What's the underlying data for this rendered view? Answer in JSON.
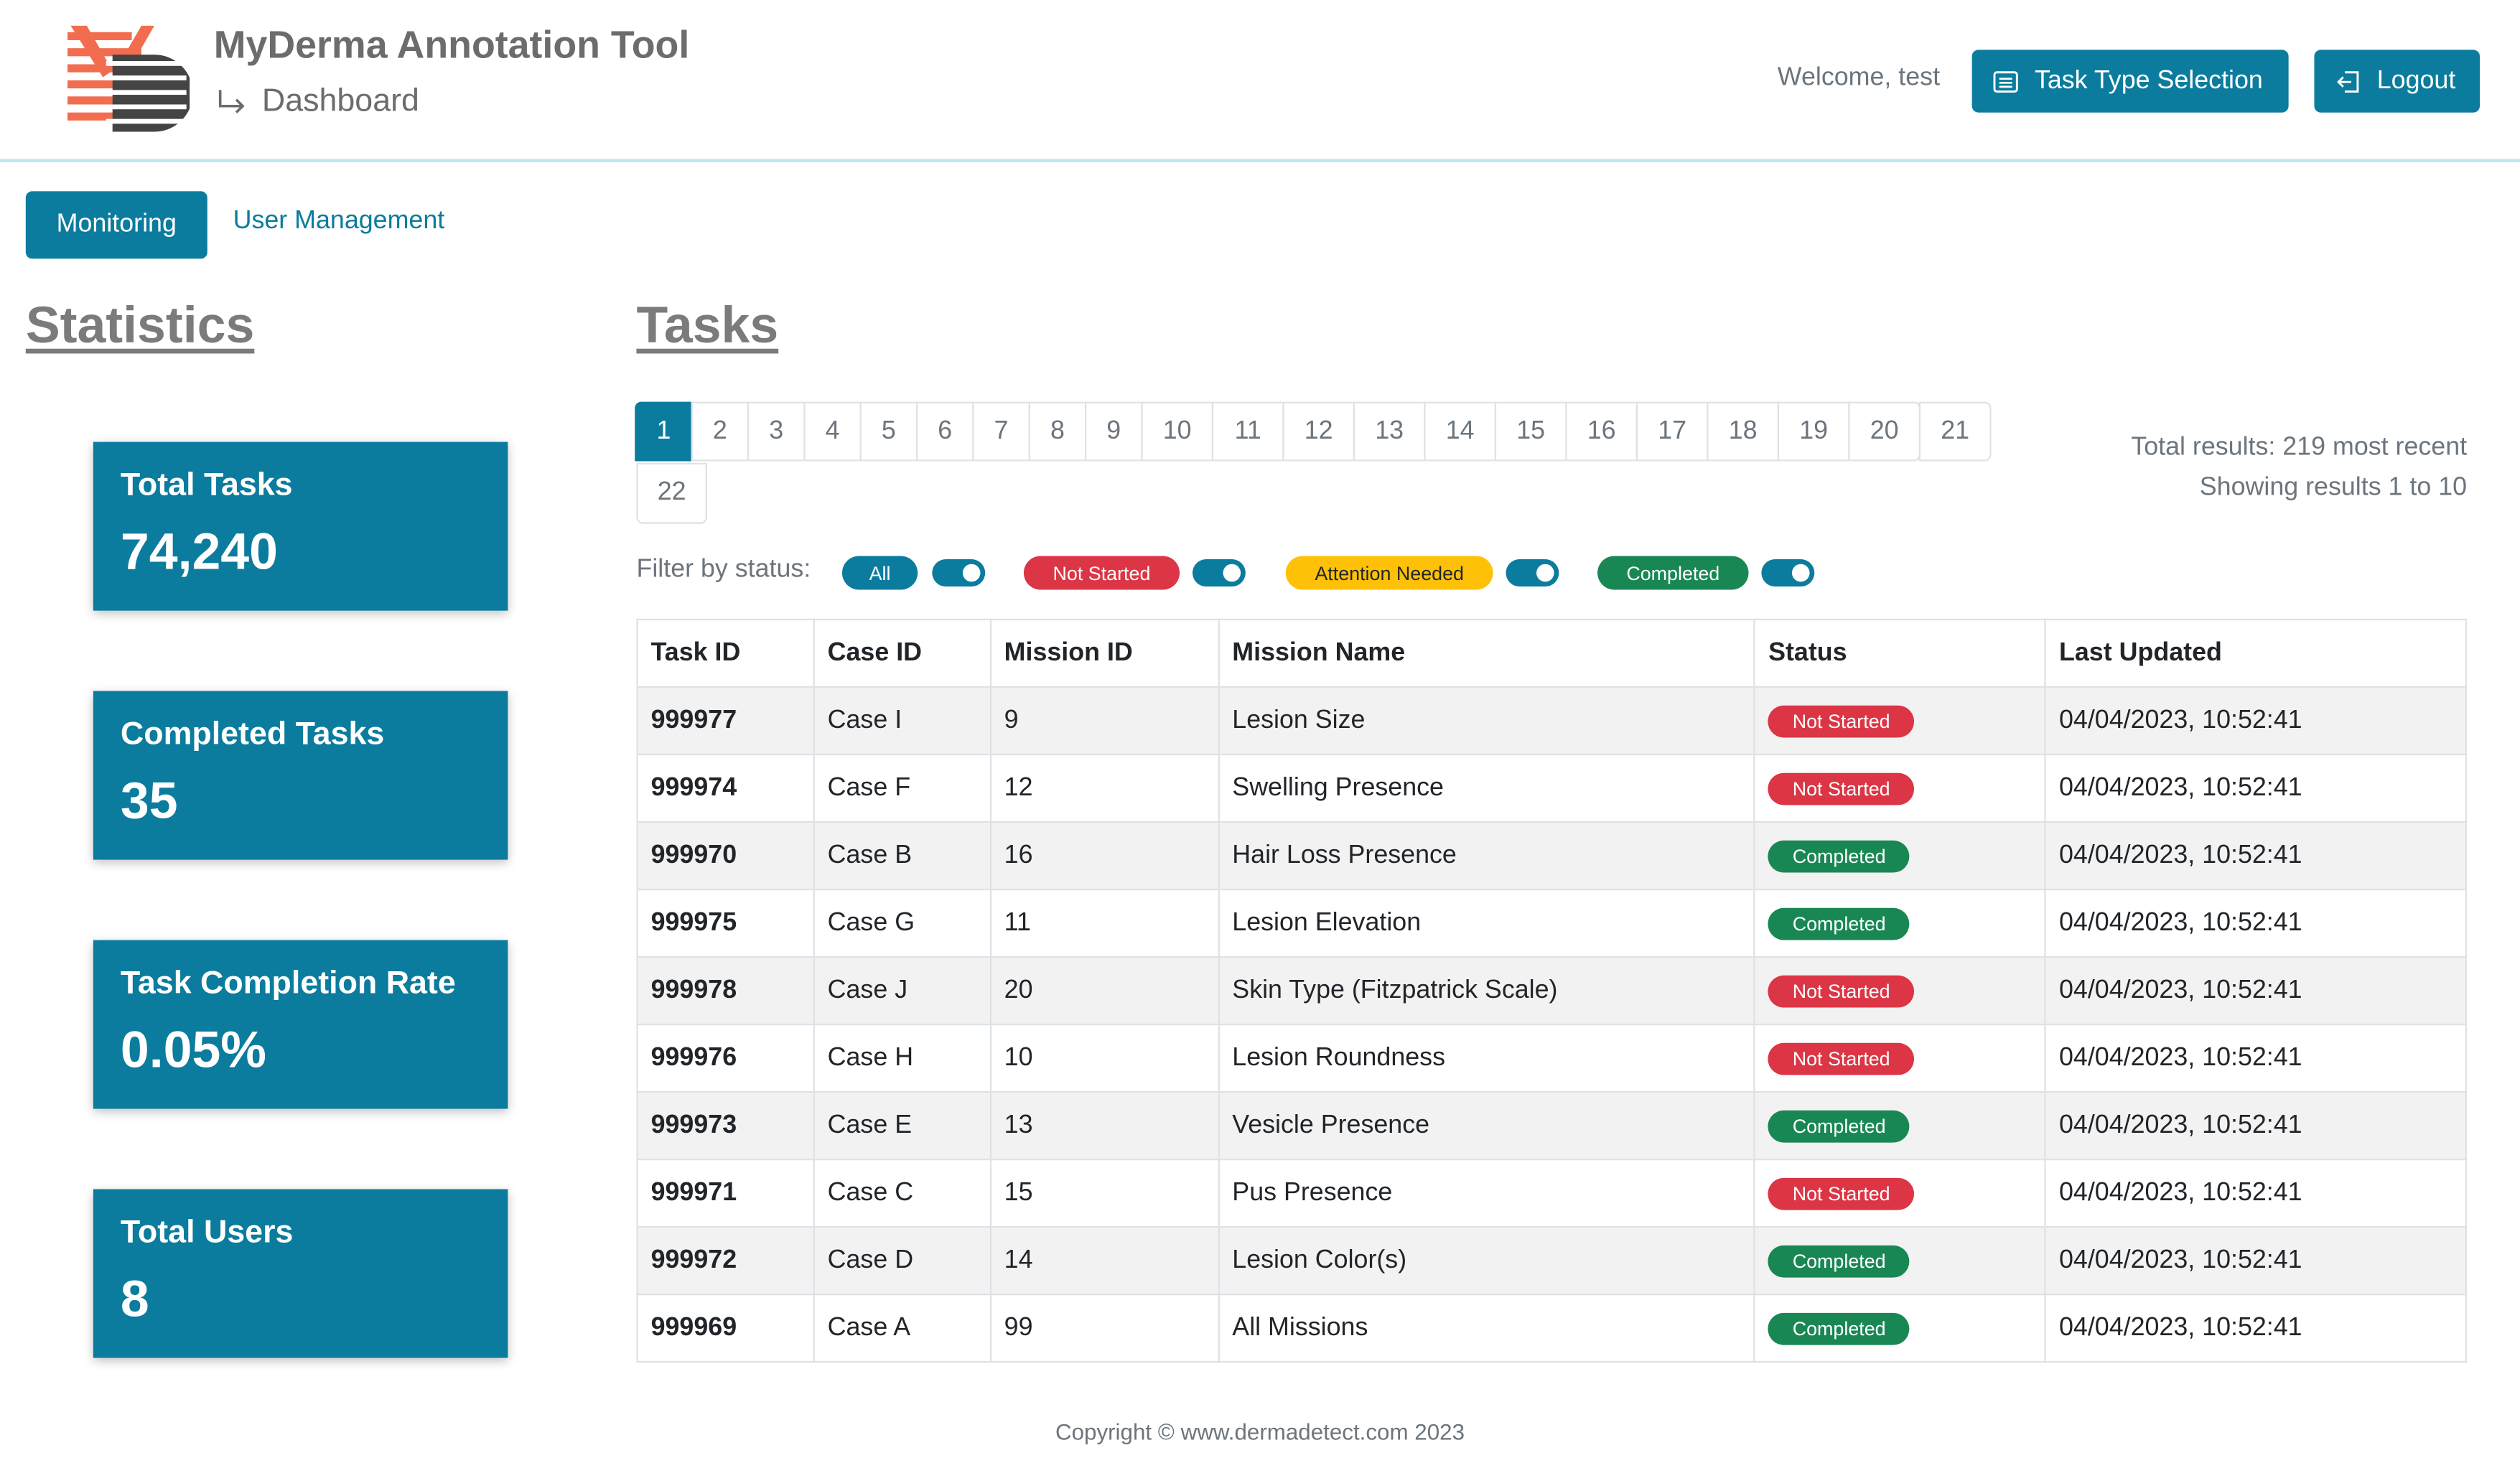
{
  "header": {
    "app_title": "MyDerma Annotation Tool",
    "subtitle": "Dashboard",
    "welcome": "Welcome, test",
    "task_type_button": "Task Type Selection",
    "logout_button": "Logout"
  },
  "nav": {
    "monitoring": "Monitoring",
    "user_management": "User Management"
  },
  "statistics": {
    "title": "Statistics",
    "cards": [
      {
        "label": "Total Tasks",
        "value": "74,240"
      },
      {
        "label": "Completed Tasks",
        "value": "35"
      },
      {
        "label": "Task Completion Rate",
        "value": "0.05%"
      },
      {
        "label": "Total Users",
        "value": "8"
      }
    ]
  },
  "tasks": {
    "title": "Tasks",
    "pages": [
      "1",
      "2",
      "3",
      "4",
      "5",
      "6",
      "7",
      "8",
      "9",
      "10",
      "11",
      "12",
      "13",
      "14",
      "15",
      "16",
      "17",
      "18",
      "19",
      "20",
      "21",
      "22"
    ],
    "active_page": "1",
    "results_total": "Total results: 219 most recent",
    "results_showing": "Showing results 1 to 10",
    "filter_label": "Filter by status:",
    "filters": [
      {
        "label": "All",
        "color": "#0b7c9e",
        "enabled": true
      },
      {
        "label": "Not Started",
        "color": "#dc3545",
        "enabled": true
      },
      {
        "label": "Attention Needed",
        "color": "#ffc107",
        "enabled": true
      },
      {
        "label": "Completed",
        "color": "#198754",
        "enabled": true
      }
    ],
    "columns": [
      "Task ID",
      "Case ID",
      "Mission ID",
      "Mission Name",
      "Status",
      "Last Updated"
    ],
    "rows": [
      {
        "task_id": "999977",
        "case_id": "Case I",
        "mission_id": "9",
        "mission_name": "Lesion Size",
        "status": "Not Started",
        "updated": "04/04/2023, 10:52:41"
      },
      {
        "task_id": "999974",
        "case_id": "Case F",
        "mission_id": "12",
        "mission_name": "Swelling Presence",
        "status": "Not Started",
        "updated": "04/04/2023, 10:52:41"
      },
      {
        "task_id": "999970",
        "case_id": "Case B",
        "mission_id": "16",
        "mission_name": "Hair Loss Presence",
        "status": "Completed",
        "updated": "04/04/2023, 10:52:41"
      },
      {
        "task_id": "999975",
        "case_id": "Case G",
        "mission_id": "11",
        "mission_name": "Lesion Elevation",
        "status": "Completed",
        "updated": "04/04/2023, 10:52:41"
      },
      {
        "task_id": "999978",
        "case_id": "Case J",
        "mission_id": "20",
        "mission_name": "Skin Type (Fitzpatrick Scale)",
        "status": "Not Started",
        "updated": "04/04/2023, 10:52:41"
      },
      {
        "task_id": "999976",
        "case_id": "Case H",
        "mission_id": "10",
        "mission_name": "Lesion Roundness",
        "status": "Not Started",
        "updated": "04/04/2023, 10:52:41"
      },
      {
        "task_id": "999973",
        "case_id": "Case E",
        "mission_id": "13",
        "mission_name": "Vesicle Presence",
        "status": "Completed",
        "updated": "04/04/2023, 10:52:41"
      },
      {
        "task_id": "999971",
        "case_id": "Case C",
        "mission_id": "15",
        "mission_name": "Pus Presence",
        "status": "Not Started",
        "updated": "04/04/2023, 10:52:41"
      },
      {
        "task_id": "999972",
        "case_id": "Case D",
        "mission_id": "14",
        "mission_name": "Lesion Color(s)",
        "status": "Completed",
        "updated": "04/04/2023, 10:52:41"
      },
      {
        "task_id": "999969",
        "case_id": "Case A",
        "mission_id": "99",
        "mission_name": "All Missions",
        "status": "Completed",
        "updated": "04/04/2023, 10:52:41"
      }
    ]
  },
  "footer": {
    "copyright": "Copyright © www.dermadetect.com 2023"
  },
  "colors": {
    "primary": "#0b7c9e",
    "danger": "#dc3545",
    "warning": "#ffc107",
    "success": "#198754"
  }
}
